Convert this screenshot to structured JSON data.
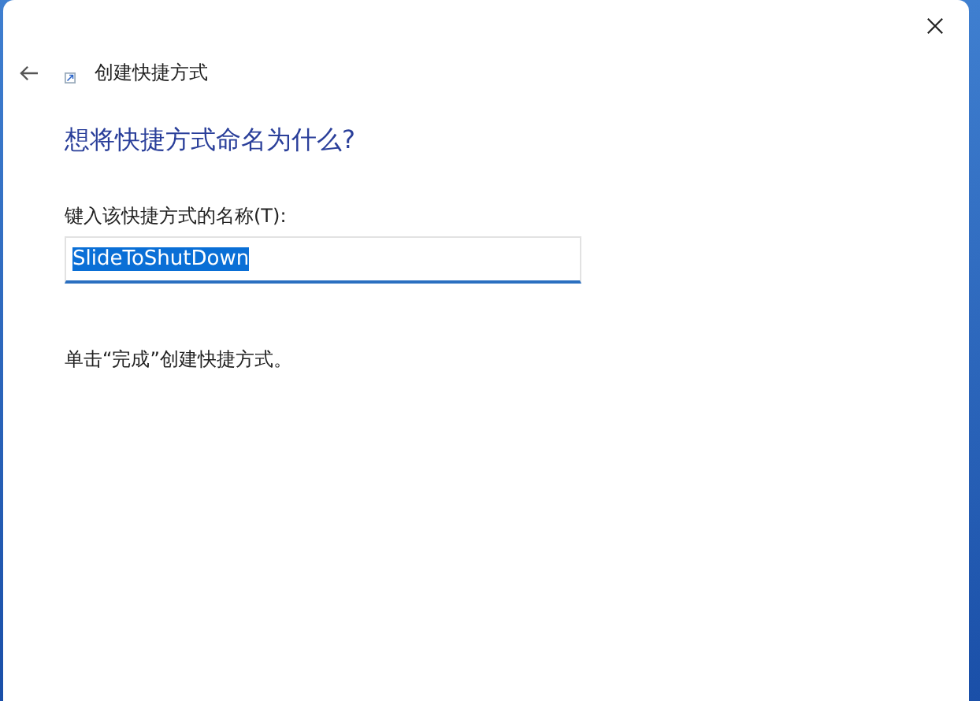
{
  "window": {
    "title": "创建快捷方式"
  },
  "heading": "想将快捷方式命名为什么?",
  "name_field": {
    "label": "键入该快捷方式的名称(T):",
    "value": "SlideToShutDown",
    "selected": true
  },
  "hint": "单击“完成”创建快捷方式。"
}
